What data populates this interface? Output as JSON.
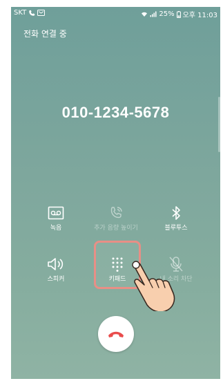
{
  "status_bar": {
    "carrier": "SKT",
    "battery": "25%",
    "time": "오후 11:03"
  },
  "call": {
    "status": "전화 연결 중",
    "number": "010-1234-5678"
  },
  "controls": [
    {
      "label": "녹음",
      "icon": "voicemail-icon",
      "enabled": true
    },
    {
      "label": "추가 음량 높이기",
      "icon": "volume-boost-icon",
      "enabled": false
    },
    {
      "label": "블루투스",
      "icon": "bluetooth-icon",
      "enabled": true
    },
    {
      "label": "스피커",
      "icon": "speaker-icon",
      "enabled": true
    },
    {
      "label": "키패드",
      "icon": "keypad-icon",
      "enabled": true
    },
    {
      "label": "내 소리 차단",
      "icon": "mic-off-icon",
      "enabled": false
    }
  ],
  "end_call": {
    "icon": "end-call-icon",
    "color": "#e94c4c"
  }
}
